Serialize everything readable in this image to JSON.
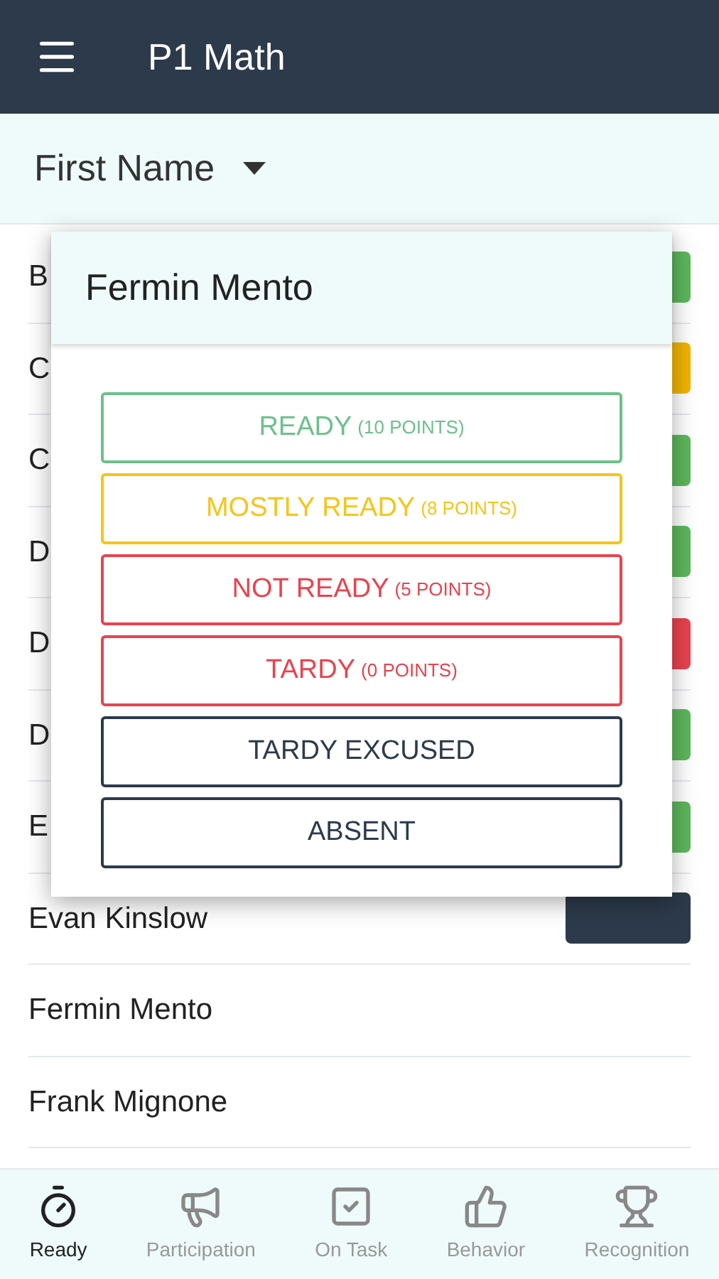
{
  "app_bar": {
    "title": "P1 Math"
  },
  "sort": {
    "label": "First Name"
  },
  "students": [
    {
      "name": "B",
      "color": "#5cb85c"
    },
    {
      "name": "C",
      "color": "#f0b400"
    },
    {
      "name": "C",
      "color": "#5cb85c"
    },
    {
      "name": "D",
      "color": "#5cb85c"
    },
    {
      "name": "D",
      "color": "#e8434f"
    },
    {
      "name": "D",
      "color": "#5cb85c"
    },
    {
      "name": "E",
      "color": "#5cb85c"
    },
    {
      "name": "Evan Kinslow",
      "color": "#2c3a4b"
    },
    {
      "name": "Fermin Mento"
    },
    {
      "name": "Frank Mignone"
    }
  ],
  "dialog": {
    "title": "Fermin Mento",
    "options": [
      {
        "label": "READY",
        "points": "(10 POINTS)",
        "color": "#6cc08b"
      },
      {
        "label": "MOSTLY READY",
        "points": "(8 POINTS)",
        "color": "#f5c518"
      },
      {
        "label": "NOT READY",
        "points": "(5 POINTS)",
        "color": "#e8434f"
      },
      {
        "label": "TARDY",
        "points": "(0 POINTS)",
        "color": "#e8434f"
      },
      {
        "label": "TARDY EXCUSED",
        "color": "#2c3a4b"
      },
      {
        "label": "ABSENT",
        "color": "#2c3a4b"
      }
    ]
  },
  "bottom_nav": [
    {
      "label": "Ready",
      "selected": true
    },
    {
      "label": "Participation",
      "selected": false
    },
    {
      "label": "On Task",
      "selected": false
    },
    {
      "label": "Behavior",
      "selected": false
    },
    {
      "label": "Recognition",
      "selected": false
    }
  ]
}
